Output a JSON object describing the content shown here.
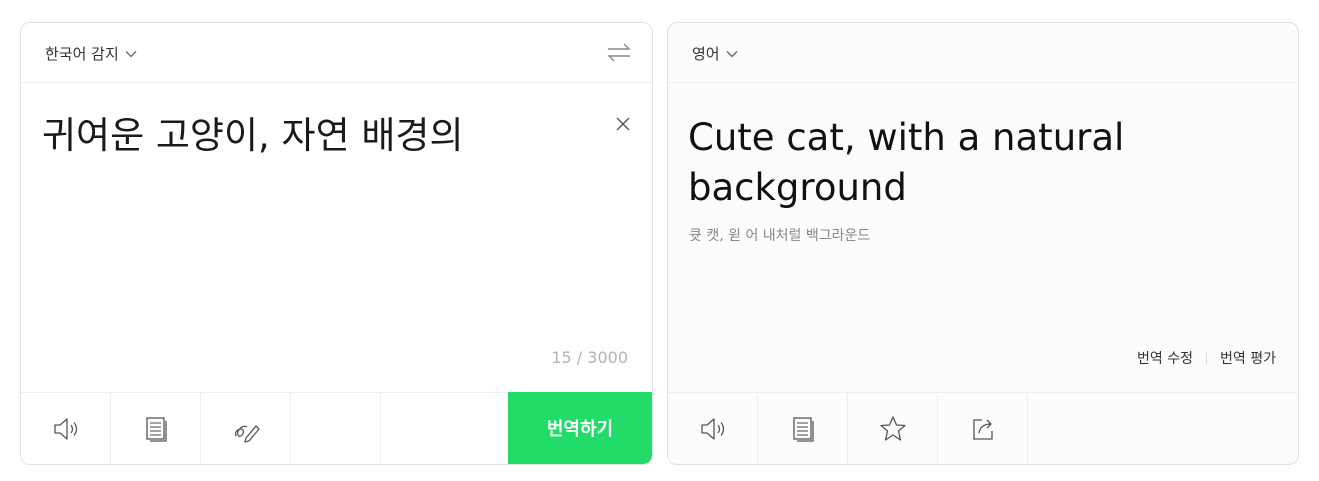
{
  "source_panel": {
    "language_label": "한국어 감지",
    "text": "귀여운 고양이, 자연 배경의",
    "char_count": "15 / 3000",
    "translate_label": "번역하기",
    "icons": [
      "speaker-icon",
      "copy-icon",
      "handwriting-icon",
      "swap-icon",
      "close-icon",
      "chevron-down-icon"
    ]
  },
  "target_panel": {
    "language_label": "영어",
    "text": "Cute cat, with a natural background",
    "pronunciation": "큣 캣, 윋 어 내처럴 백그라운드",
    "edit_label": "번역 수정",
    "rate_label": "번역 평가",
    "icons": [
      "speaker-icon",
      "copy-icon",
      "star-icon",
      "share-icon",
      "chevron-down-icon"
    ]
  },
  "colors": {
    "accent": "#22dc6a",
    "border": "#e2e2e2",
    "muted_text": "#b3b3b3"
  }
}
